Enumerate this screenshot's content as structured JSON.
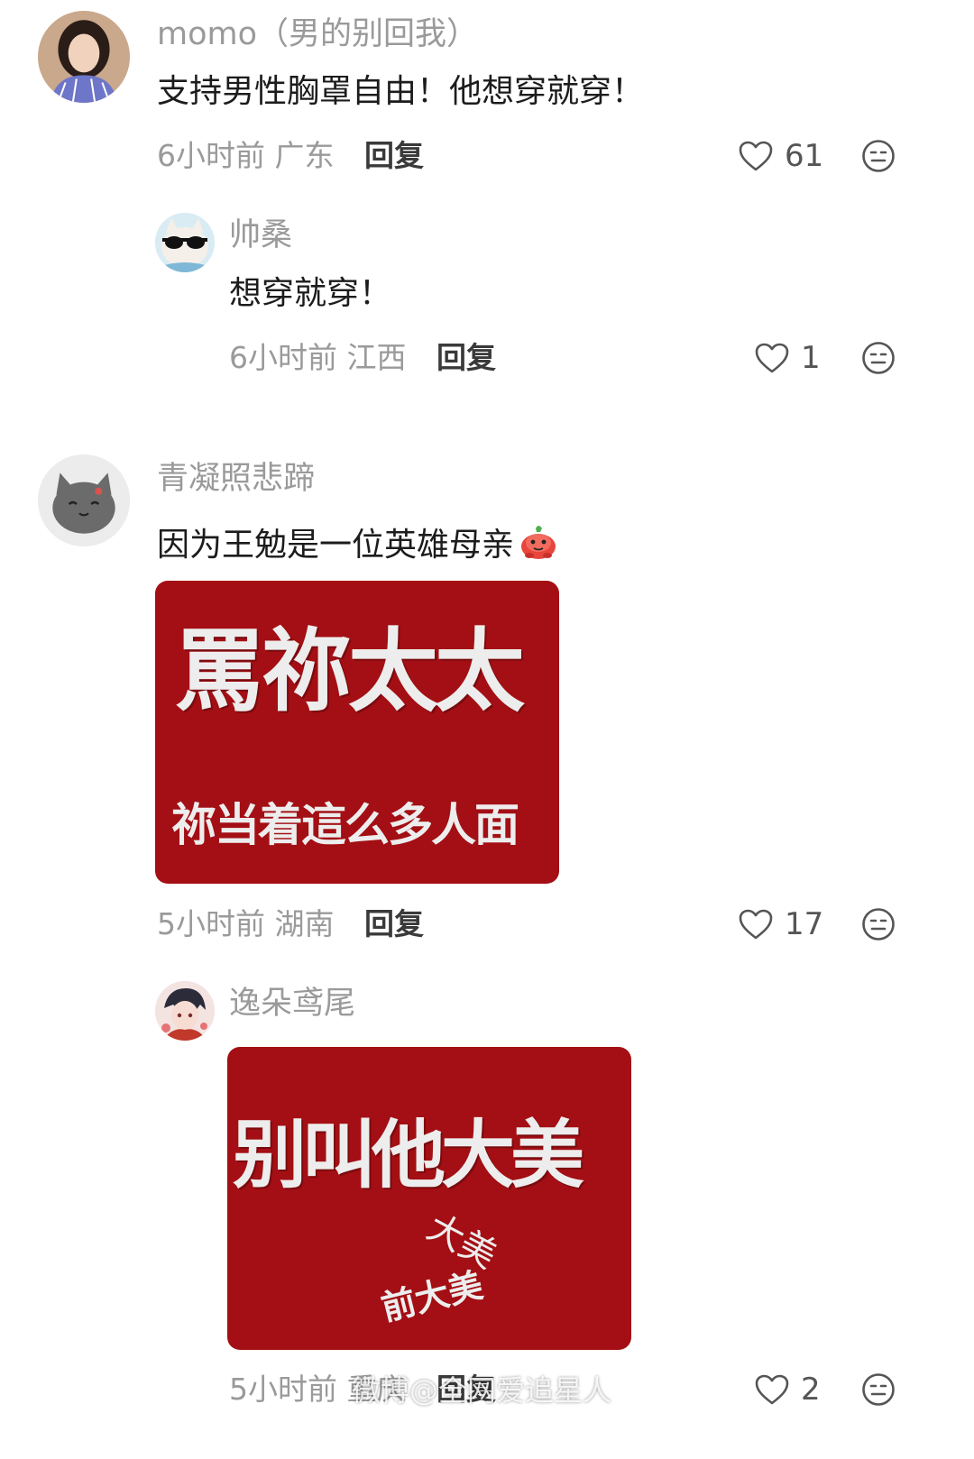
{
  "comments": [
    {
      "name": "momo（男的别回我）",
      "text": "支持男性胸罩自由！他想穿就穿！",
      "time_location": "6小时前 广东",
      "reply_label": "回复",
      "likes": "61"
    },
    {
      "name": "帅桑",
      "text": "想穿就穿！",
      "time_location": "6小时前 江西",
      "reply_label": "回复",
      "likes": "1"
    },
    {
      "name": "青凝照悲蹄",
      "text": "因为王勉是一位英雄母亲",
      "time_location": "5小时前 湖南",
      "reply_label": "回复",
      "likes": "17",
      "image": {
        "title": "罵祢太太",
        "subtitle": "祢当着這么多人面"
      }
    },
    {
      "name": "逸朵鸢尾",
      "time_location": "5小时前 重庆",
      "reply_label": "回复",
      "likes": "2",
      "image": {
        "title": "别叫他大美",
        "scribble": "大美",
        "subtitle": "前大美"
      }
    }
  ],
  "watermark": "微博@全网爱追星人",
  "icons": {
    "like": "heart-outline-icon",
    "dislike": "neutral-face-icon",
    "emoji": "red-blob-emoji-icon"
  },
  "colors": {
    "meme_background": "#a30f14",
    "meta_text": "#9a9a9a"
  }
}
